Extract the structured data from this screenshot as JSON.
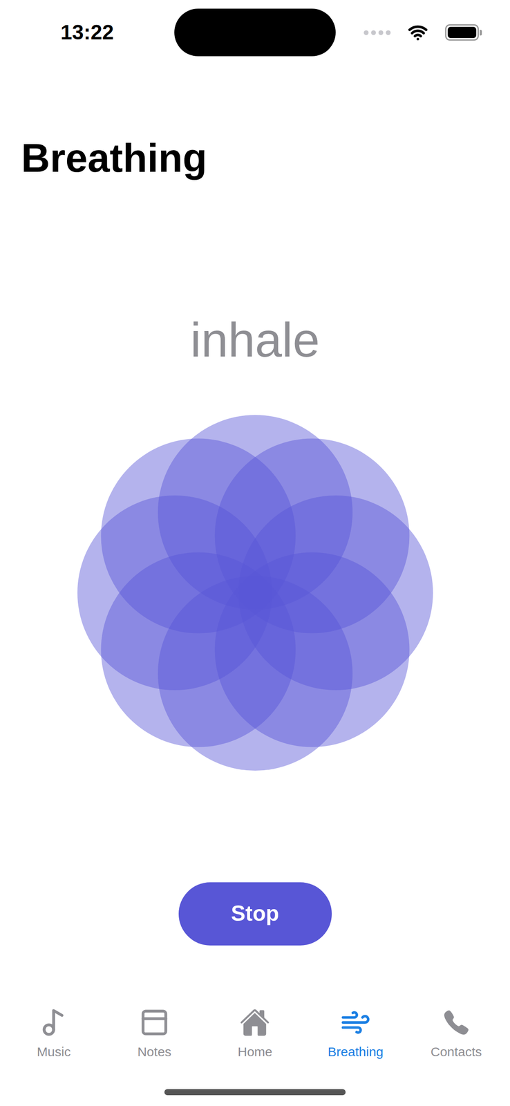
{
  "status_bar": {
    "time": "13:22"
  },
  "title": "Breathing",
  "phase": "inhale",
  "button": "Stop",
  "tabs": [
    {
      "label": "Music",
      "selected": false
    },
    {
      "label": "Notes",
      "selected": false
    },
    {
      "label": "Home",
      "selected": false
    },
    {
      "label": "Breathing",
      "selected": true
    },
    {
      "label": "Contacts",
      "selected": false
    }
  ]
}
